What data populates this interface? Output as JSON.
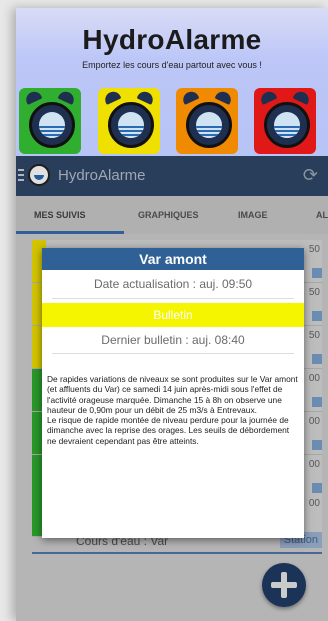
{
  "banner": {
    "title": "HydroAlarme",
    "subtitle": "Emportez les cours d'eau partout avec vous !",
    "clock_colors": [
      "#2fae2f",
      "#f0e000",
      "#f08a00",
      "#e01818"
    ]
  },
  "appbar": {
    "title": "HydroAlarme",
    "icons": [
      "menu-icon",
      "app-logo-icon",
      "refresh-icon"
    ]
  },
  "tabs": [
    {
      "label": "MES SUIVIS",
      "active": true
    },
    {
      "label": "GRAPHIQUES",
      "active": false
    },
    {
      "label": "IMAGE",
      "active": false
    },
    {
      "label": "AL",
      "active": false
    }
  ],
  "background_list": {
    "times": [
      "50",
      "50",
      "50",
      "00",
      "00",
      "00",
      "00"
    ],
    "footer_label": "Cours d'eau : Var",
    "footer_button": "Station"
  },
  "dialog": {
    "title": "Var amont",
    "date_label": "Date actualisation : auj. 09:50",
    "bulletin_button": "Bulletin",
    "last_bulletin": "Dernier bulletin : auj. 08:40",
    "body_paragraphs": [
      "De rapides variations de niveaux se sont produites sur le Var amont (et affluents du Var) ce samedi 14 juin après-midi sous l'effet de l'activité orageuse marquée. Dimanche 15 à 8h on observe une hauteur de 0,90m pour un débit de 25 m3/s à Entrevaux.",
      "Le risque de rapide montée de niveau perdure pour la journée de dimanche avec la reprise des orages. Les seuils de débordement ne devraient cependant pas être atteints."
    ],
    "colors": {
      "header": "#2f6196",
      "bulletin": "#f5f500"
    }
  }
}
